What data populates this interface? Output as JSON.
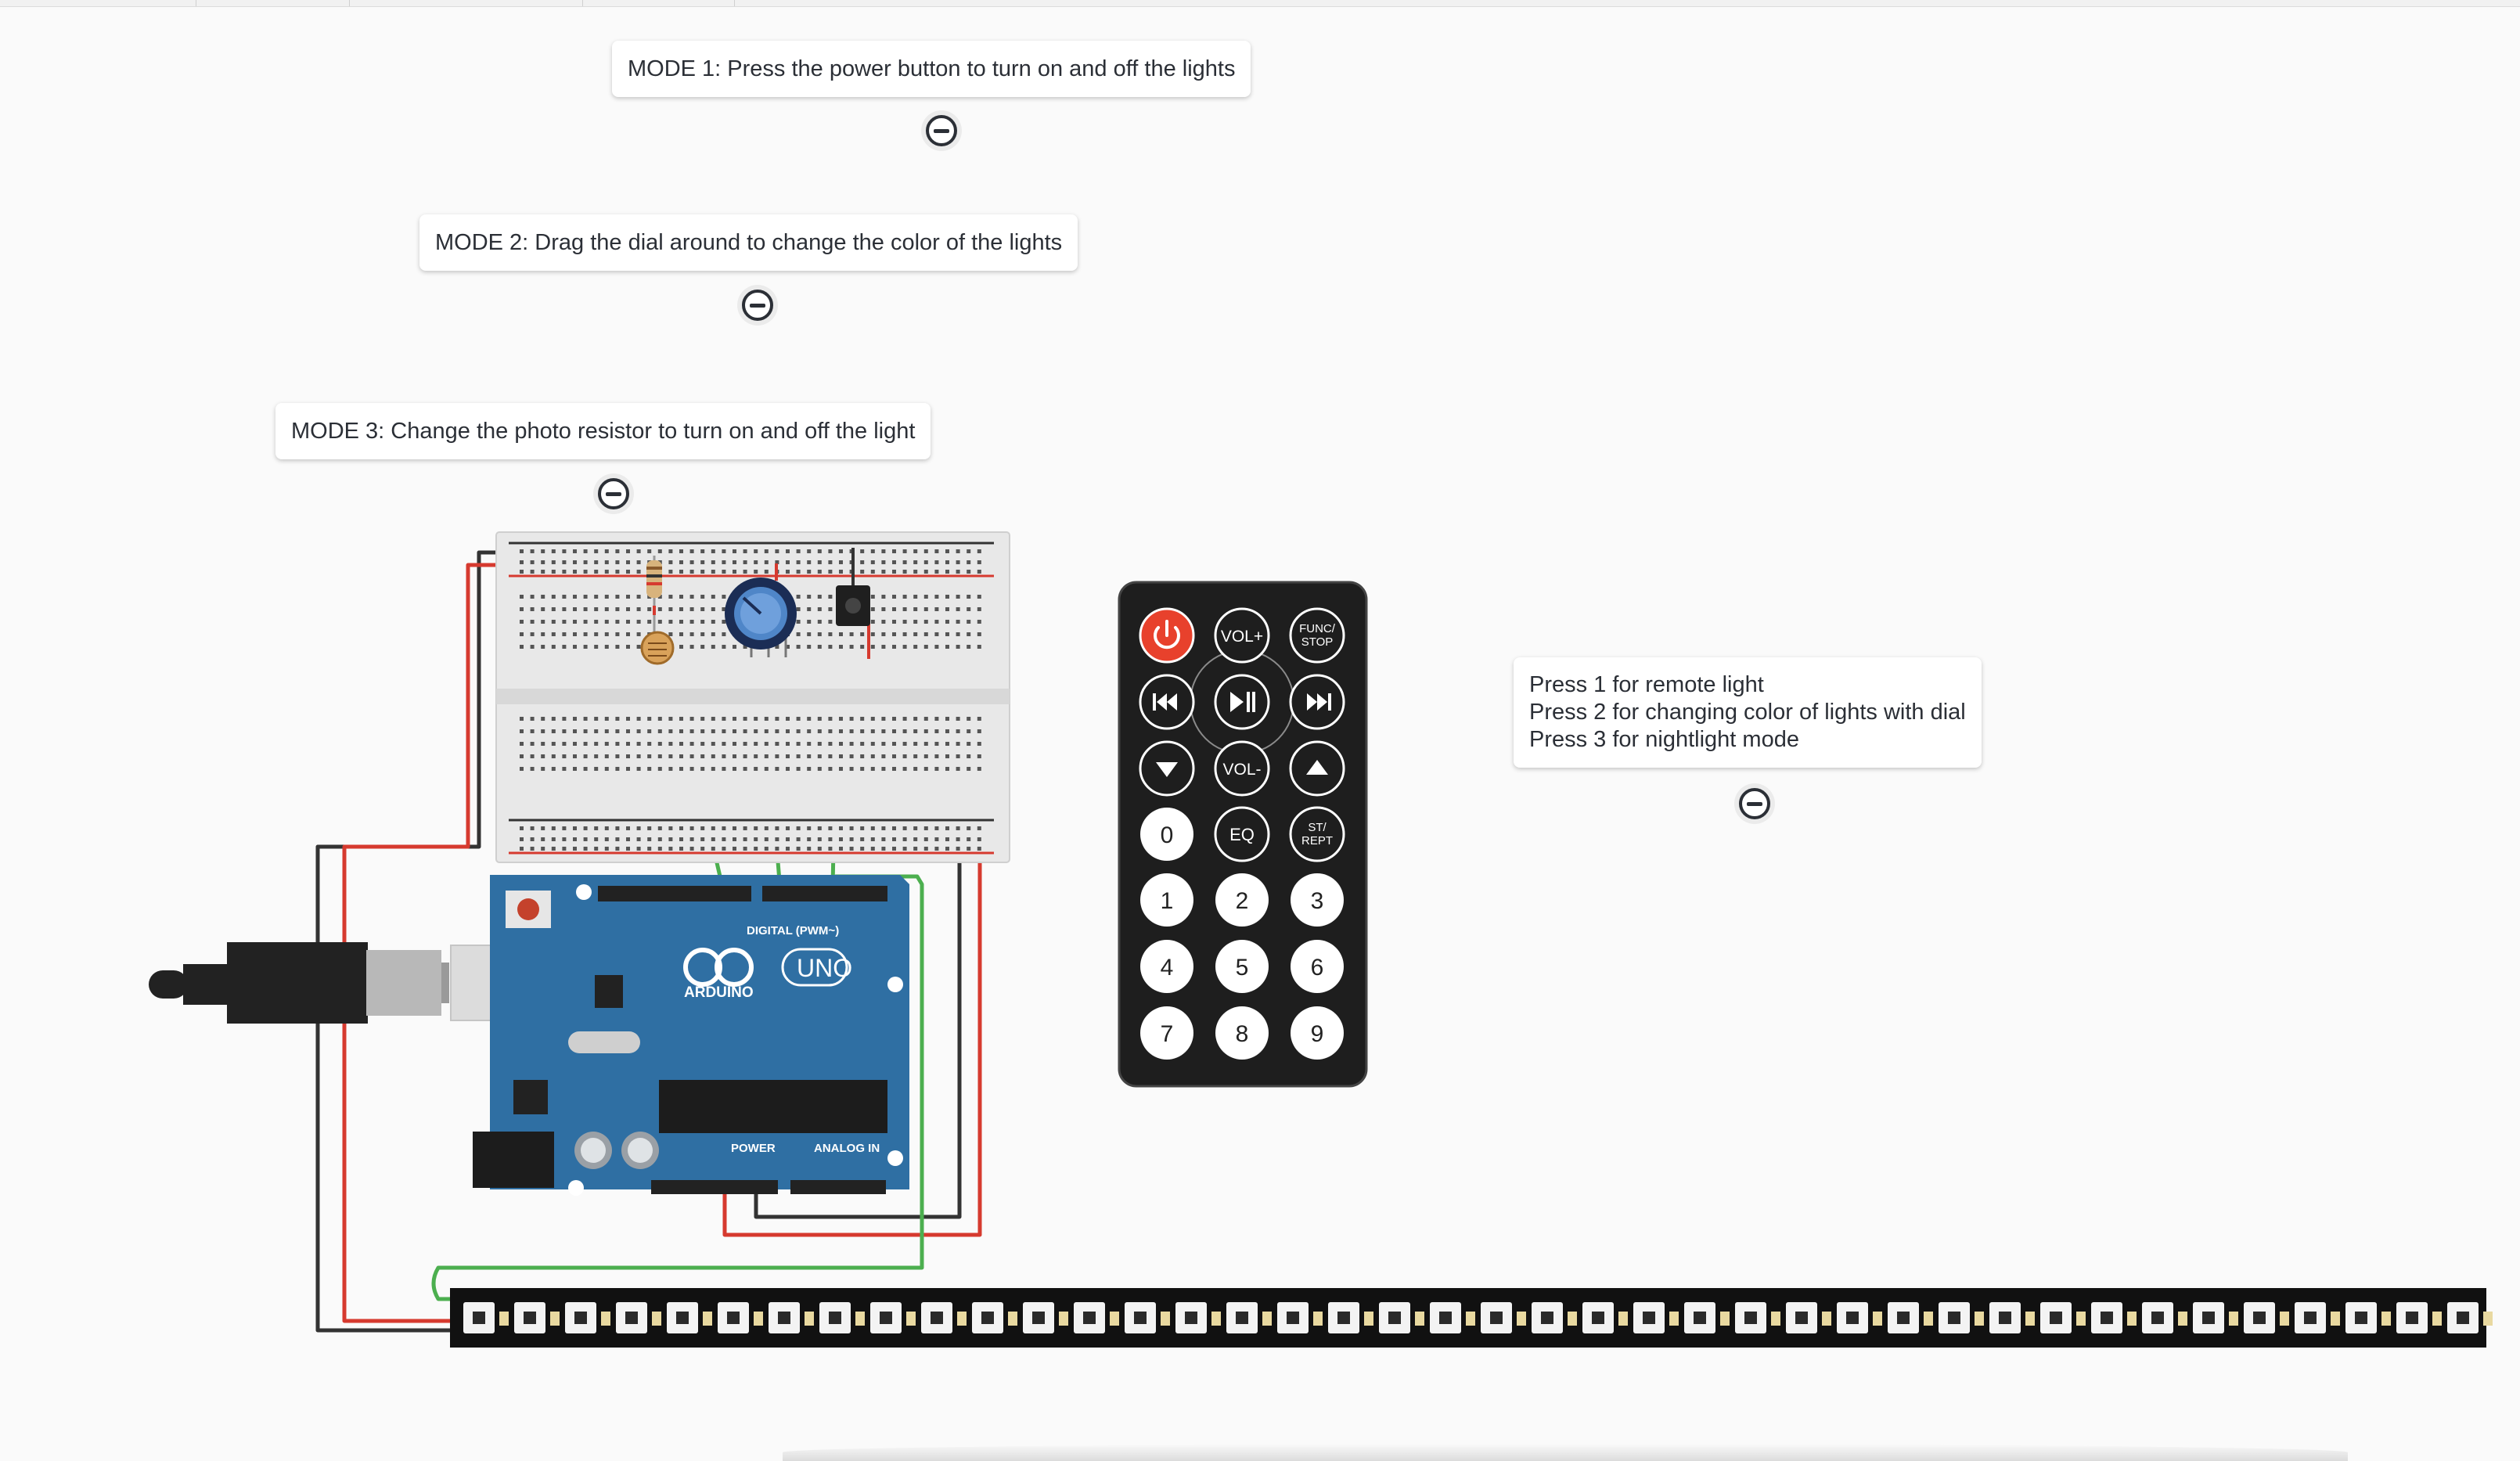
{
  "notes": {
    "mode1": "MODE 1: Press the power button to turn on and off the lights",
    "mode2": "MODE 2: Drag the dial around to change the color of the lights",
    "mode3": "MODE 3: Change the photo resistor to turn on and off the light",
    "legend": [
      "Press 1 for remote light",
      "Press 2 for changing color of lights with dial",
      "Press 3 for nightlight mode"
    ]
  },
  "remote": {
    "buttons": {
      "vol_up": "VOL+",
      "func_stop_1": "FUNC/",
      "func_stop_2": "STOP",
      "vol_down": "VOL-",
      "eq": "EQ",
      "st_rept_1": "ST/",
      "st_rept_2": "REPT",
      "digits": [
        "0",
        "1",
        "2",
        "3",
        "4",
        "5",
        "6",
        "7",
        "8",
        "9"
      ]
    },
    "power_color": "#e8412c"
  },
  "arduino": {
    "brand": "ARDUINO",
    "model": "UNO",
    "digital_label": "DIGITAL (PWM~)",
    "power_label": "POWER",
    "analog_label": "ANALOG IN",
    "board_color": "#2f6fa3"
  },
  "colors": {
    "wire_red": "#d63a2f",
    "wire_black": "#333333",
    "wire_green": "#4caf4f",
    "strip": "#111111"
  }
}
